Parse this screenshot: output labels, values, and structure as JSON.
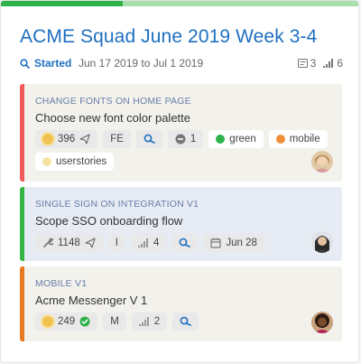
{
  "progress": 0.34,
  "colors": {
    "accent": "#1e6fc0",
    "done": "#2eb24a"
  },
  "header": {
    "title": "ACME Squad June 2019 Week 3-4",
    "status": "Started",
    "date_range": "Jun 17 2019 to Jul 1 2019",
    "story_count": "3",
    "points_total": "6"
  },
  "items": [
    {
      "epic": "CHANGE FONTS ON HOME PAGE",
      "name": "Choose new font color palette",
      "bar_color": "#ef5a5a",
      "bg": "#f2f1ec",
      "points": "396",
      "size": "FE",
      "estimate": "1",
      "labels": [
        {
          "text": "green",
          "color": "#2eb24a"
        },
        {
          "text": "mobile",
          "color": "#f0913a"
        },
        {
          "text": "userstories",
          "color": "#f4e3a1"
        }
      ]
    },
    {
      "epic": "SINGLE SIGN ON INTEGRATION V1",
      "name": "Scope SSO onboarding flow",
      "bar_color": "#35b544",
      "bg": "#e6ebf4",
      "points": "1148",
      "size": "I",
      "estimate": "4",
      "due": "Jun 28"
    },
    {
      "epic": "MOBILE V1",
      "name": "Acme Messenger V 1",
      "bar_color": "#e8781f",
      "bg": "#f2f1ec",
      "points": "249",
      "size": "M",
      "estimate": "2"
    }
  ]
}
